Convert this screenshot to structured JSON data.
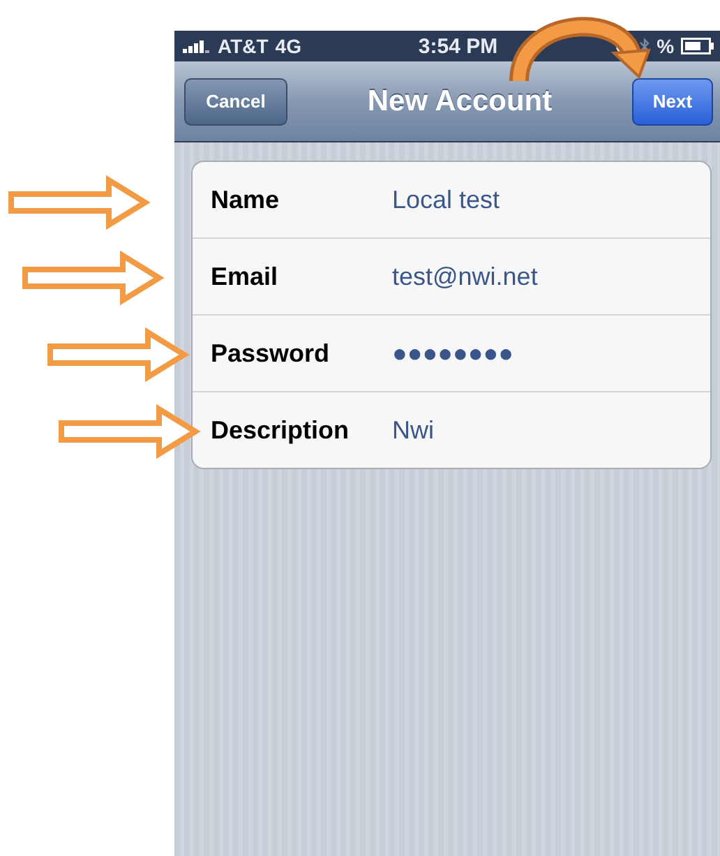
{
  "status_bar": {
    "carrier": "AT&T",
    "network": "4G",
    "time": "3:54 PM",
    "battery": "%"
  },
  "nav_bar": {
    "left_button": "Cancel",
    "title": "New Account",
    "right_button": "Next"
  },
  "fields": [
    {
      "label": "Name",
      "value": "Local test"
    },
    {
      "label": "Email",
      "value": "test@nwi.net"
    },
    {
      "label": "Password",
      "value": "●●●●●●●●"
    },
    {
      "label": "Description",
      "value": "Nwi"
    }
  ]
}
